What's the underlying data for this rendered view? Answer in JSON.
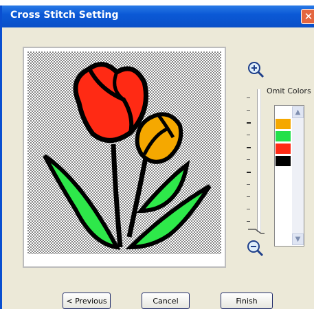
{
  "window": {
    "title": "Cross Stitch Setting"
  },
  "omit_colors": {
    "label": "Omit Colors",
    "swatches": [
      "#ffffff",
      "#f5a800",
      "#22e04a",
      "#ff2a14",
      "#000000"
    ]
  },
  "buttons": {
    "previous": "< Previous",
    "cancel": "Cancel",
    "finish": "Finish"
  },
  "icons": {
    "zoom_in": "zoom-in-icon",
    "zoom_out": "zoom-out-icon",
    "close": "close-icon"
  }
}
